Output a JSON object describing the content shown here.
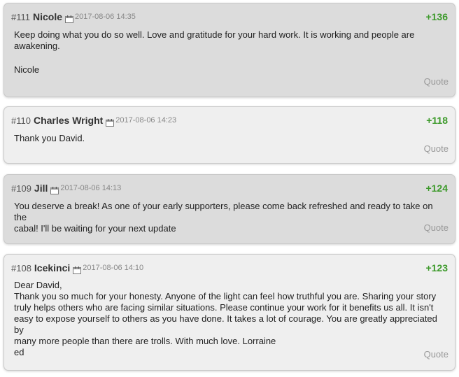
{
  "comments": [
    {
      "number": "#111",
      "author": "Nicole",
      "date": "2017-08-06 14:35",
      "score": "+136",
      "lines": [
        "Keep doing what you do so well. Love and gratitude for your hard work. It is working and people are",
        "awakening.",
        "",
        "Nicole"
      ],
      "quote": "Quote"
    },
    {
      "number": "#110",
      "author": "Charles Wright",
      "date": "2017-08-06 14:23",
      "score": "+118",
      "lines": [
        "Thank you David."
      ],
      "quote": "Quote"
    },
    {
      "number": "#109",
      "author": "Jill",
      "date": "2017-08-06 14:13",
      "score": "+124",
      "lines": [
        "You deserve a break! As one of your early supporters, please come back refreshed and ready to take on the",
        "cabal! I'll be waiting for your next update"
      ],
      "quote": "Quote"
    },
    {
      "number": "#108",
      "author": "Icekinci",
      "date": "2017-08-06 14:10",
      "score": "+123",
      "lines": [
        "Dear David,",
        "Thank you so much for your honesty. Anyone of the light can feel how truthful you are. Sharing your story",
        "truly helps others who are facing similar situations. Please continue your work for it benefits us all. It isn't",
        "easy to expose yourself to others as you have done. It takes a lot of courage. You are greatly appreciated by",
        "many more people than there are trolls. With much love. Lorraine",
        "ed"
      ],
      "quote": "Quote"
    }
  ],
  "icons": {
    "date": "calendar-icon"
  },
  "colors": {
    "score": "#3d9a2b",
    "author": "#333333",
    "quote": "#999999"
  }
}
